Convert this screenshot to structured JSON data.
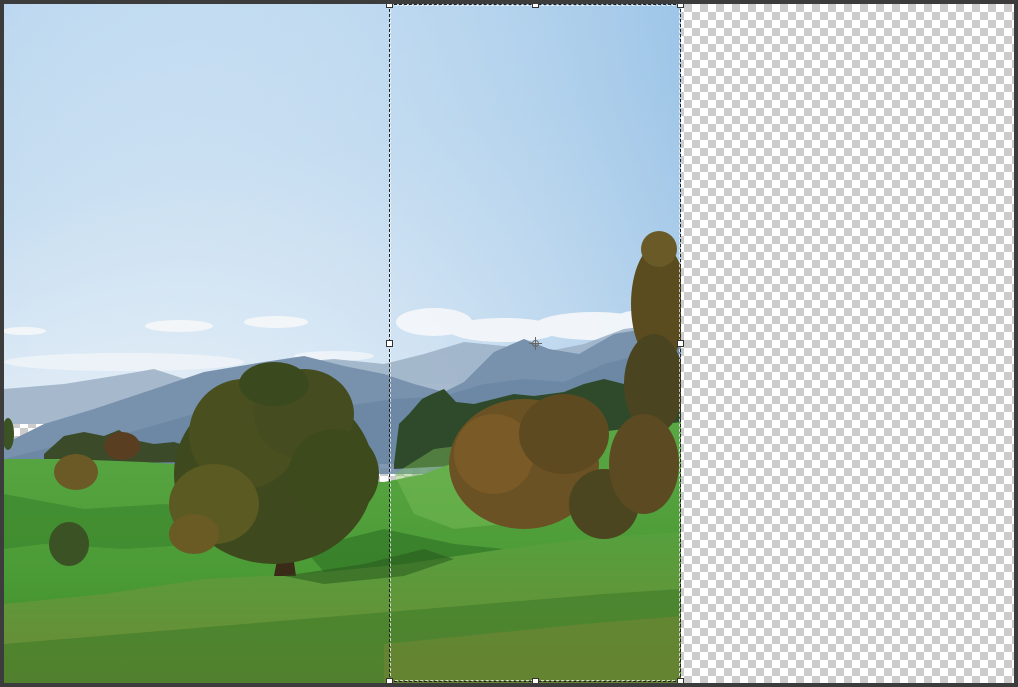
{
  "document": {
    "canvas_background": "transparent-checkerboard",
    "image_content": "landscape-photo-meadow-trees-mountains"
  },
  "colors": {
    "workspace": "#3c3c3c",
    "sky_top": "#8fbde3",
    "sky_bottom": "#dceaf6",
    "mountains": "#6d8aa6",
    "grass": "#4e9a3b",
    "tree_foliage": "#4a4a1e",
    "selection_border": "#222222",
    "checker_light": "#ffffff",
    "checker_dark": "#cccccc"
  },
  "tool": {
    "mode": "free-transform",
    "reference_point_icon": "crosshair-pivot-icon"
  }
}
